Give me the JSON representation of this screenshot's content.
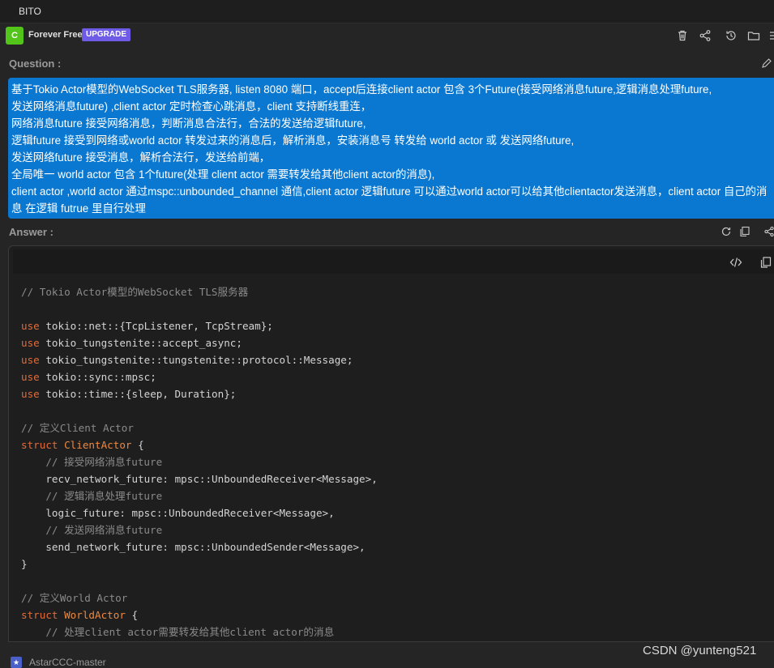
{
  "window": {
    "title": "BITO"
  },
  "toolbar": {
    "avatar_letter": "C",
    "plan_label": "Forever Free",
    "upgrade_label": "UPGRADE",
    "icons": [
      "trash-icon",
      "share-icon",
      "history-icon",
      "folder-icon",
      "menu-icon"
    ]
  },
  "question": {
    "label": "Question :",
    "lines": [
      "基于Tokio Actor模型的WebSocket TLS服务器, listen 8080 端口，accept后连接client actor 包含 3个Future(接受网络消息future,逻辑消息处理future,",
      "发送网络消息future) ,client actor 定时检查心跳消息，client 支持断线重连，",
      "网络消息future 接受网络消息，判断消息合法行，合法的发送给逻辑future,",
      "逻辑future 接受到网络或world actor 转发过来的消息后，解析消息，安装消息号 转发给 world actor 或  发送网络future,",
      "发送网络future 接受消息，解析合法行，发送给前端，",
      "全局唯一 world actor 包含 1个future(处理 client actor  需要转发给其他client actor的消息),",
      "client actor ,world actor 通过mspc::unbounded_channel 通信,client actor 逻辑future 可以通过world actor可以给其他clientactor发送消息，client actor 自己的消息 在逻辑 futrue 里自行处理"
    ]
  },
  "answer": {
    "label": "Answer :",
    "code": {
      "comment_title": "// Tokio Actor模型的WebSocket TLS服务器",
      "uses": [
        {
          "kw": "use",
          "path": " tokio::net::{TcpListener, TcpStream};"
        },
        {
          "kw": "use",
          "path": " tokio_tungstenite::accept_async;"
        },
        {
          "kw": "use",
          "path": " tokio_tungstenite::tungstenite::protocol::Message;"
        },
        {
          "kw": "use",
          "path": " tokio::sync::mpsc;"
        },
        {
          "kw": "use",
          "path": " tokio::time::{sleep, Duration};"
        }
      ],
      "client_comment": "// 定义Client Actor",
      "struct_kw": "struct",
      "client_name": "ClientActor",
      "open_brace": " {",
      "client_fields": [
        {
          "comment": "// 接受网络消息future",
          "field": "recv_network_future: mpsc::UnboundedReceiver<Message>,"
        },
        {
          "comment": "// 逻辑消息处理future",
          "field": "logic_future: mpsc::UnboundedReceiver<Message>,"
        },
        {
          "comment": "// 发送网络消息future",
          "field": "send_network_future: mpsc::UnboundedSender<Message>,"
        }
      ],
      "close_brace": "}",
      "world_comment": "// 定义World Actor",
      "world_name": "WorldActor",
      "world_field_comment": "// 处理client actor需要转发给其他client actor的消息"
    }
  },
  "footer": {
    "project": "AstarCCC-master",
    "watermark": "CSDN @yunteng521"
  }
}
